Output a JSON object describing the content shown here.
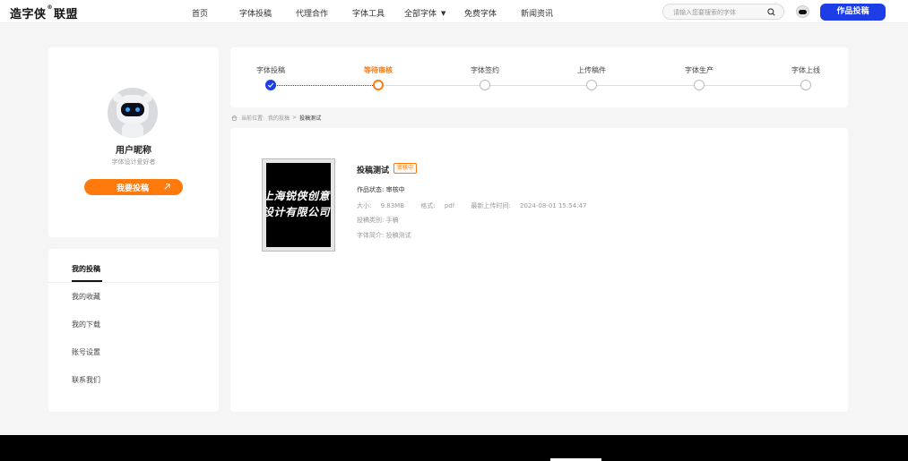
{
  "header": {
    "logo_text": "造字侠",
    "logo_mark": "®",
    "logo_suffix": "联盟",
    "nav": [
      {
        "label": "首页"
      },
      {
        "label": "字体投稿"
      },
      {
        "label": "代理合作"
      },
      {
        "label": "字体工具"
      },
      {
        "label": "全部字体",
        "has_dropdown": true
      },
      {
        "label": "免费字体"
      },
      {
        "label": "新闻资讯"
      }
    ],
    "search_placeholder": "请输入您要搜索的字体",
    "submit_label": "作品投稿"
  },
  "profile": {
    "name": "用户昵称",
    "desc": "字体设计爱好者",
    "submit_label": "我要投稿"
  },
  "menu": {
    "items": [
      {
        "label": "我的投稿",
        "active": true
      },
      {
        "label": "我的收藏"
      },
      {
        "label": "我的下载"
      },
      {
        "label": "账号设置"
      },
      {
        "label": "联系我们"
      }
    ]
  },
  "steps": {
    "items": [
      {
        "label": "字体投稿",
        "state": "done"
      },
      {
        "label": "等待审核",
        "state": "current"
      },
      {
        "label": "字体签约",
        "state": "pending"
      },
      {
        "label": "上传稿件",
        "state": "pending"
      },
      {
        "label": "字体生产",
        "state": "pending"
      },
      {
        "label": "字体上线",
        "state": "pending"
      }
    ]
  },
  "breadcrumb": {
    "prefix": "当前位置:",
    "items": [
      "我的投稿",
      "投稿测试"
    ]
  },
  "detail": {
    "title": "投稿测试",
    "badge": "审核中",
    "status_label": "作品状态:",
    "status_value": "审核中",
    "size_label": "大小:",
    "size_value": "9.83MB",
    "format_label": "格式:",
    "format_value": "pdf",
    "updated_label": "最新上传时间:",
    "updated_value": "2024-08-01 15:54:47",
    "category_label": "投稿类别:",
    "category_value": "手稿",
    "intro_label": "字体简介:",
    "intro_value": "投稿测试",
    "thumb_lines": [
      "上海锐侠创意",
      "设计有限公司"
    ]
  },
  "colors": {
    "brand_blue": "#1d3ee6",
    "accent_orange": "#ff7a0d"
  },
  "icons": {
    "search": "search-icon",
    "arrow": "arrow-up-right-icon",
    "check": "check-icon",
    "home": "home-icon"
  }
}
